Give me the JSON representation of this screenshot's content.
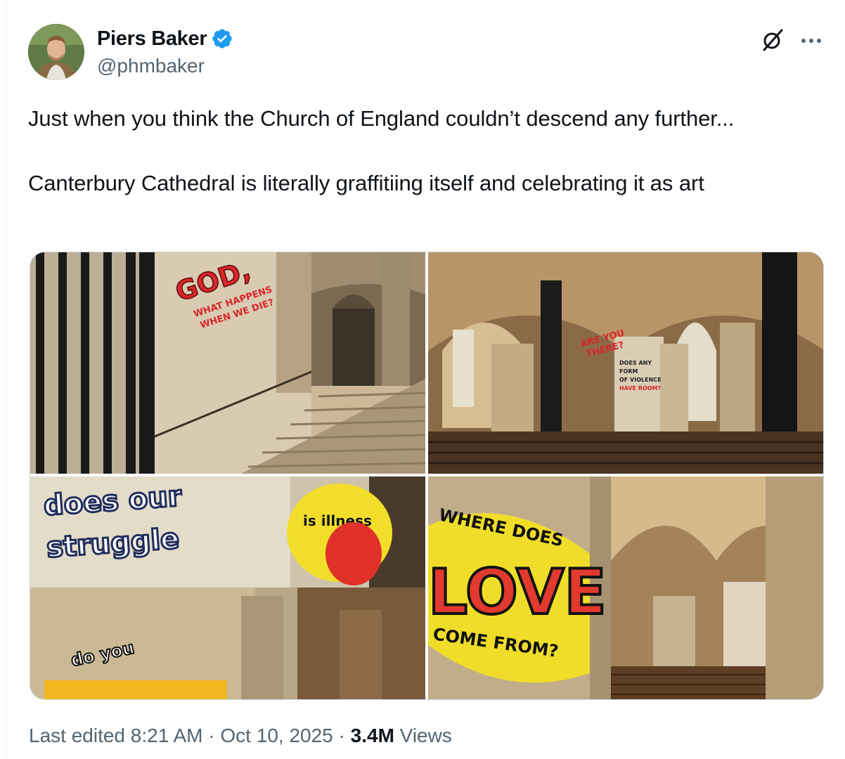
{
  "author": {
    "name": "Piers Baker",
    "handle": "@phmbaker",
    "verified": true,
    "verified_color": "#1d9bf0"
  },
  "tweet": {
    "line1": "Just when you think the Church of England couldn’t descend any further...",
    "line2": "Canterbury Cathedral is literally graffitiing itself and celebrating it as art"
  },
  "media": {
    "image_count": 4,
    "images": [
      {
        "graffiti": [
          "GOD",
          "WHAT HAPPENS WHEN WE DIE?"
        ]
      },
      {
        "graffiti": [
          "ARE YOU THERE?",
          "DOES ANY FORM OF VIOLENCE HAVE ROOM?"
        ]
      },
      {
        "graffiti": [
          "does our struggle",
          "is illness",
          "do you"
        ]
      },
      {
        "graffiti": [
          "WHERE DOES",
          "LOVE",
          "COME FROM?"
        ]
      }
    ]
  },
  "footer": {
    "edited": "Last edited 8:21 AM",
    "sep1": " · ",
    "date": "Oct 10, 2025",
    "sep2": " · ",
    "views_count": "3.4M",
    "views_label": " Views"
  },
  "icons": {
    "grok": "grok-icon",
    "more": "more-icon"
  },
  "colors": {
    "text": "#0f1419",
    "secondary": "#536471",
    "border": "#cfd9de"
  }
}
